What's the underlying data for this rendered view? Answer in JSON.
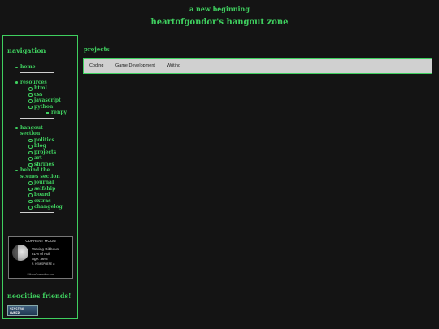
{
  "header": {
    "tagline": "a new beginning",
    "title": "heartofgondor's hangout zone"
  },
  "sidebar": {
    "nav_title": "navigation",
    "items": {
      "home": "home",
      "resources": "resources",
      "html": "html",
      "css": "css",
      "javascript": "javascript",
      "python": "python",
      "renpy": "renpy",
      "hangout_1": "hangout",
      "hangout_2": "section",
      "politics": "politics",
      "blog": "blog",
      "projects": "projects",
      "art": "art",
      "shrines": "shrines",
      "behind_1": "behind the",
      "behind_2": "scenes section",
      "journal": "journal",
      "selfship": "selfship",
      "board": "board",
      "extras": "extras",
      "changelog": "changelog"
    },
    "moon": {
      "title": "CURRENT MOON",
      "phase": "Waxing Gibbous",
      "percent": "81% of Full",
      "age": "Age: 36%",
      "hemisphere": "N. HEMISPHERE ⊕",
      "footer": "©MoonConnection.com"
    },
    "friends_title": "neocities friends!",
    "friend_button": {
      "line1": "SESSION",
      "line2": "OWNER"
    }
  },
  "main": {
    "heading": "projects",
    "tabs": [
      "Coding",
      "Game Development",
      "Writing"
    ]
  },
  "colors": {
    "background": "#141414",
    "accent": "#3fcf5f",
    "tab_bar": "#d0d0d0"
  }
}
